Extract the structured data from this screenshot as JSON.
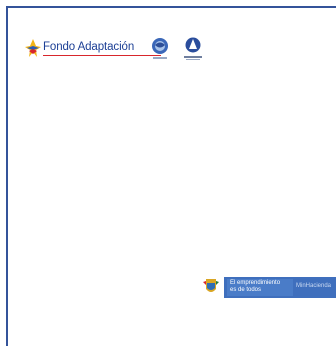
{
  "header": {
    "logo_text": "Fondo Adaptación",
    "brand_color": "#1c3f95",
    "accent_color": "#d8262c",
    "seal_icons": [
      "institutional-seal-icon",
      "institutional-emblem-icon"
    ]
  },
  "footer": {
    "banner_line1": "El emprendimiento",
    "banner_line2": "es de todos",
    "banner_sub": "MinHacienda",
    "banner_color": "#3f6fbd",
    "shield_icon": "colombia-coat-of-arms-icon"
  }
}
